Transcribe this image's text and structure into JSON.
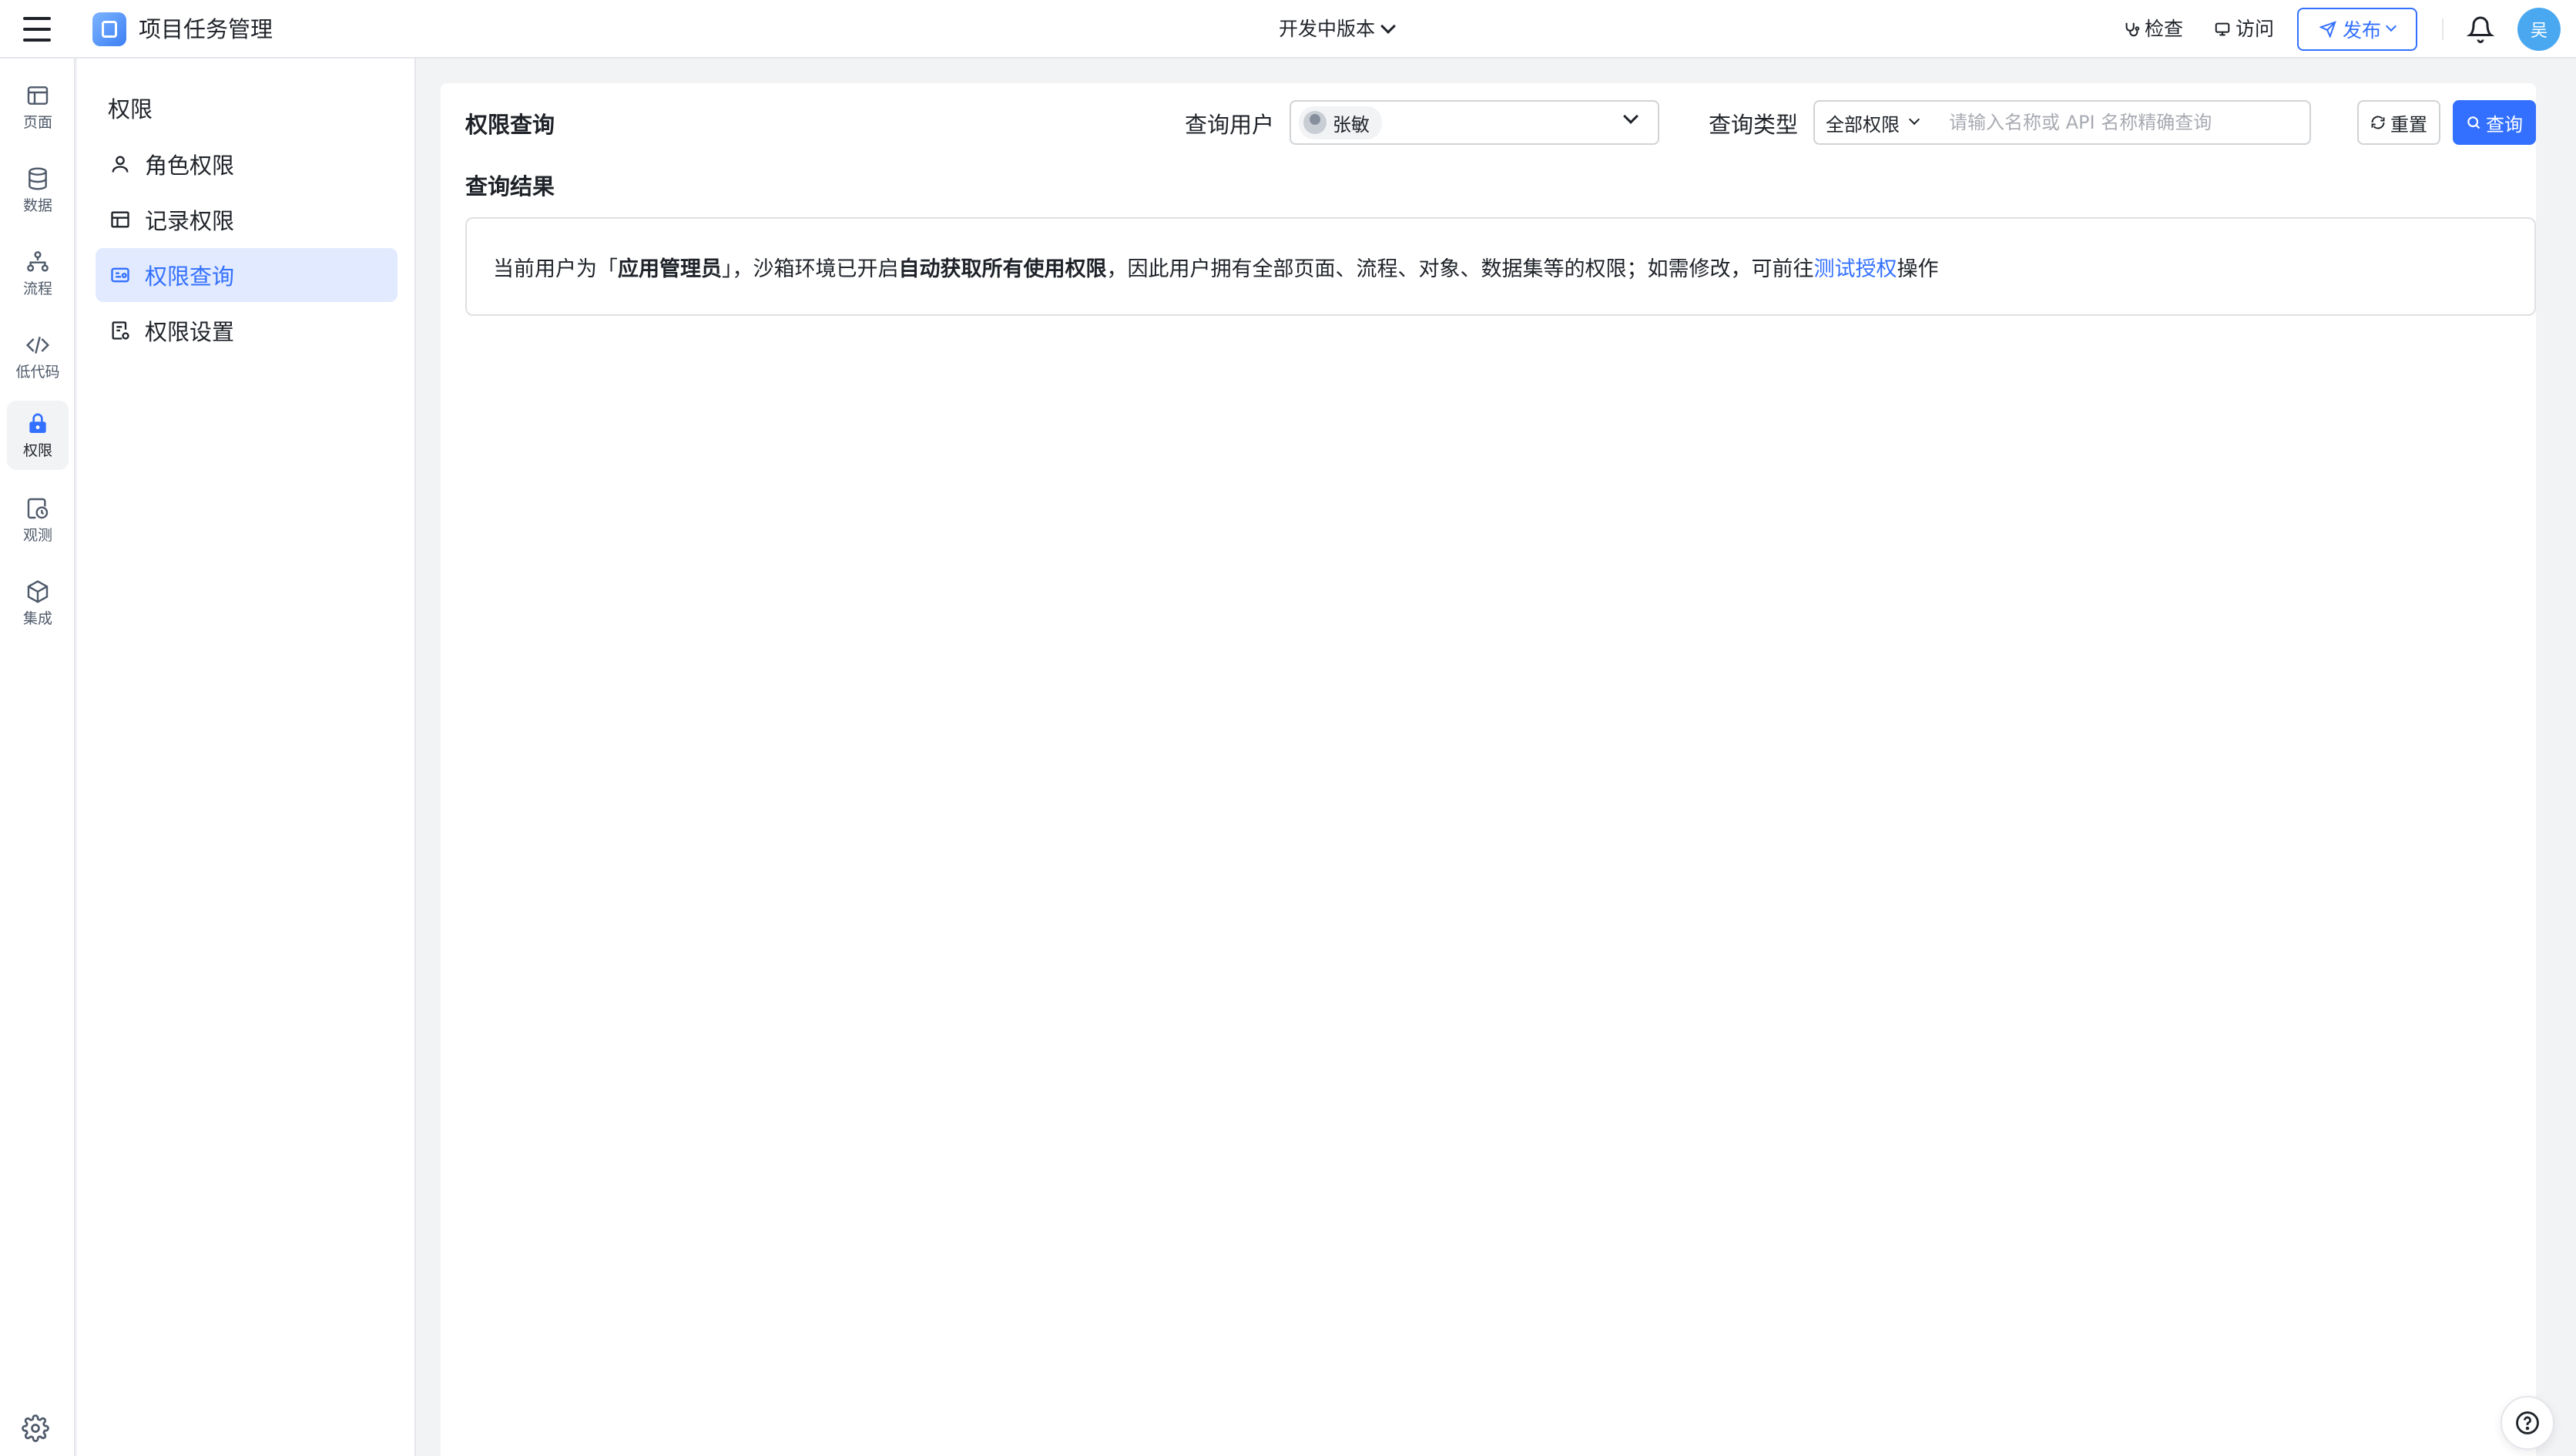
{
  "header": {
    "app_title": "项目任务管理",
    "version_label": "开发中版本",
    "check_label": "检查",
    "visit_label": "访问",
    "publish_label": "发布",
    "avatar_text": "吴"
  },
  "rail": {
    "items": [
      {
        "label": "页面",
        "icon": "page-icon"
      },
      {
        "label": "数据",
        "icon": "database-icon"
      },
      {
        "label": "流程",
        "icon": "flow-icon"
      },
      {
        "label": "低代码",
        "icon": "code-icon"
      },
      {
        "label": "权限",
        "icon": "lock-icon",
        "active": true
      },
      {
        "label": "观测",
        "icon": "monitor-icon"
      },
      {
        "label": "集成",
        "icon": "cube-icon"
      }
    ]
  },
  "submenu": {
    "title": "权限",
    "items": [
      {
        "label": "角色权限",
        "icon": "user-icon"
      },
      {
        "label": "记录权限",
        "icon": "table-icon"
      },
      {
        "label": "权限查询",
        "icon": "id-card-icon",
        "active": true
      },
      {
        "label": "权限设置",
        "icon": "settings-doc-icon"
      }
    ]
  },
  "main": {
    "title": "权限查询",
    "query_user_label": "查询用户",
    "selected_user": "张敏",
    "query_type_label": "查询类型",
    "query_type_value": "全部权限",
    "search_placeholder": "请输入名称或 API 名称精确查询",
    "reset_label": "重置",
    "query_label": "查询",
    "result_title": "查询结果",
    "result": {
      "part1": "当前用户为「",
      "role": "应用管理员",
      "part2": "」，沙箱环境已开启",
      "feature": "自动获取所有使用权限",
      "part3": "，因此用户拥有全部页面、流程、对象、数据集等的权限；如需修改，可前往",
      "link": "测试授权",
      "part4": "操作"
    }
  },
  "colors": {
    "primary": "#3370ff",
    "active_bg": "#e1eaff",
    "avatar_bg": "#4aa8f0"
  }
}
